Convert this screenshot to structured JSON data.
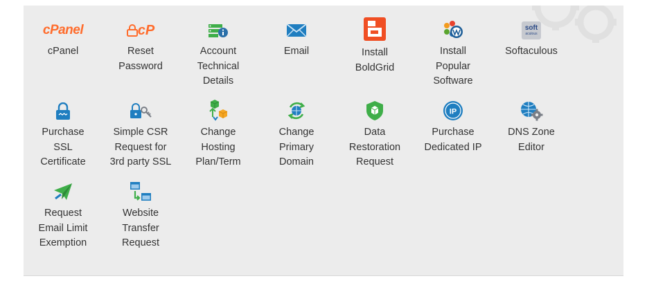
{
  "tools": [
    {
      "label": "cPanel",
      "logo_text": "cPanel"
    },
    {
      "label": "Reset\nPassword",
      "logo_text": "cP"
    },
    {
      "label": "Account\nTechnical\nDetails"
    },
    {
      "label": "Email"
    },
    {
      "label": "Install\nBoldGrid"
    },
    {
      "label": "Install\nPopular\nSoftware"
    },
    {
      "label": "Softaculous",
      "logo_text": "soft",
      "logo_sub": "aculous"
    },
    {
      "label": "Purchase\nSSL\nCertificate"
    },
    {
      "label": "Simple CSR\nRequest for\n3rd party SSL"
    },
    {
      "label": "Change\nHosting\nPlan/Term"
    },
    {
      "label": "Change\nPrimary\nDomain"
    },
    {
      "label": "Data\nRestoration\nRequest"
    },
    {
      "label": "Purchase\nDedicated IP",
      "logo_text": "IP"
    },
    {
      "label": "DNS Zone\nEditor"
    },
    {
      "label": "Request\nEmail Limit\nExemption"
    },
    {
      "label": "Website\nTransfer\nRequest"
    }
  ],
  "icons": {
    "cpanel": "cpanel-logo-icon",
    "reset": "lock-cp-icon",
    "account": "server-info-icon",
    "email": "envelope-icon",
    "boldgrid": "boldgrid-icon",
    "popular": "joomla-wordpress-icon",
    "softaculous": "softaculous-icon",
    "ssl": "padlock-icon",
    "csr": "lock-key-icon",
    "hosting": "hosting-boxes-icon",
    "domain": "globe-arrows-icon",
    "restore": "shield-box-icon",
    "dedicated_ip": "ip-badge-icon",
    "dns": "globe-gear-icon",
    "email_limit": "paper-plane-icon",
    "transfer": "website-transfer-icon"
  },
  "colors": {
    "panel_bg": "#ececec",
    "label_text": "#333333",
    "accent_orange": "#ff6c2c",
    "icon_blue": "#1f7ec0",
    "icon_green": "#3fae49"
  }
}
